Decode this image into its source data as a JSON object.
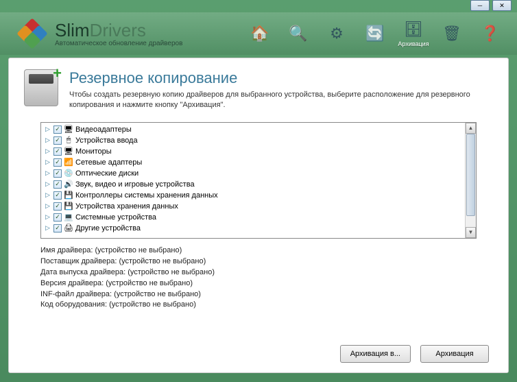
{
  "app": {
    "title_slim": "Slim",
    "title_drivers": "Drivers",
    "subtitle": "Автоматическое обновление драйверов"
  },
  "toolbar": {
    "active_label": "Архивация"
  },
  "page": {
    "title": "Резервное копирование",
    "description": "Чтобы создать резервную копию драйверов для выбранного устройства, выберите расположение для резервного копирования и нажмите кнопку \"Архивация\"."
  },
  "tree": [
    {
      "label": "Видеоадаптеры",
      "icon": "🖥"
    },
    {
      "label": "Устройства ввода",
      "icon": "🖱"
    },
    {
      "label": "Мониторы",
      "icon": "🖥"
    },
    {
      "label": "Сетевые адаптеры",
      "icon": "📶"
    },
    {
      "label": "Оптические диски",
      "icon": "💿"
    },
    {
      "label": "Звук, видео и игровые устройства",
      "icon": "🔊"
    },
    {
      "label": "Контроллеры системы хранения данных",
      "icon": "💾"
    },
    {
      "label": "Устройства хранения данных",
      "icon": "💾"
    },
    {
      "label": "Системные устройства",
      "icon": "💻"
    },
    {
      "label": "Другие устройства",
      "icon": "🖨"
    }
  ],
  "details": {
    "not_selected": "(устройство не выбрано)",
    "rows": [
      "Имя драйвера:",
      "Поставщик драйвера:",
      "Дата выпуска драйвера:",
      "Версия драйвера:",
      "INF-файл драйвера:",
      "Код оборудования:"
    ]
  },
  "buttons": {
    "archive_to": "Архивация в...",
    "archive": "Архивация"
  }
}
